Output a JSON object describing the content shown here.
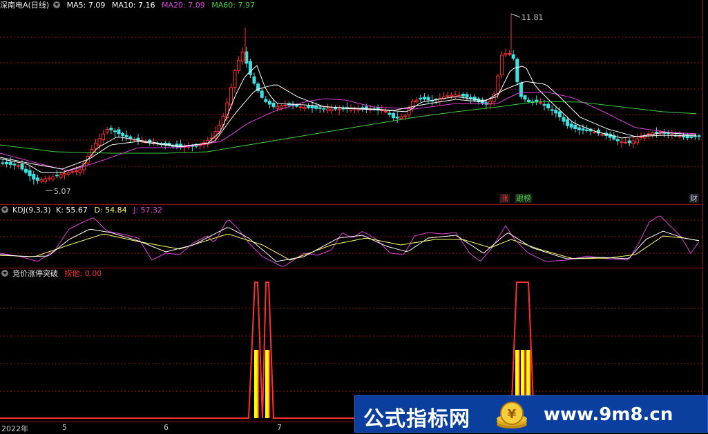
{
  "price_pane": {
    "title": "深南电A(日线)",
    "ma": [
      {
        "label": "MA5: 7.09",
        "color": "#ffffff"
      },
      {
        "label": "MA10: 7.16",
        "color": "#ffffff"
      },
      {
        "label": "MA20: 7.09",
        "color": "#e040e0"
      },
      {
        "label": "MA60: 7.97",
        "color": "#40d040"
      }
    ],
    "high_label": "11.81",
    "low_label": "5.07",
    "tags": [
      {
        "text": "涨",
        "color": "#ff3030"
      },
      {
        "text": "跟榜",
        "color": "#40d040"
      },
      {
        "text": "财",
        "color": "#c8c8ff"
      }
    ]
  },
  "kdj_pane": {
    "name": "KDJ(9,3,3)",
    "k": "K: 55.67",
    "d": "D: 54.84",
    "j": "J: 57.32",
    "colors": {
      "k": "#ffffff",
      "d": "#ffff60",
      "j": "#e040e0"
    }
  },
  "ind_pane": {
    "name": "竞价涨停突破",
    "value": "捞他: 0.00",
    "value_color": "#ff3030"
  },
  "axis": {
    "labels": [
      "2022年",
      "5",
      "6",
      "7"
    ]
  },
  "watermark": {
    "text": "公式指标网",
    "url": "www.9m8.cn"
  },
  "colors": {
    "up": "#ff3030",
    "down": "#40e0e0",
    "grid": "#a01010",
    "ma20": "#e040e0",
    "ma60": "#40d040"
  }
}
